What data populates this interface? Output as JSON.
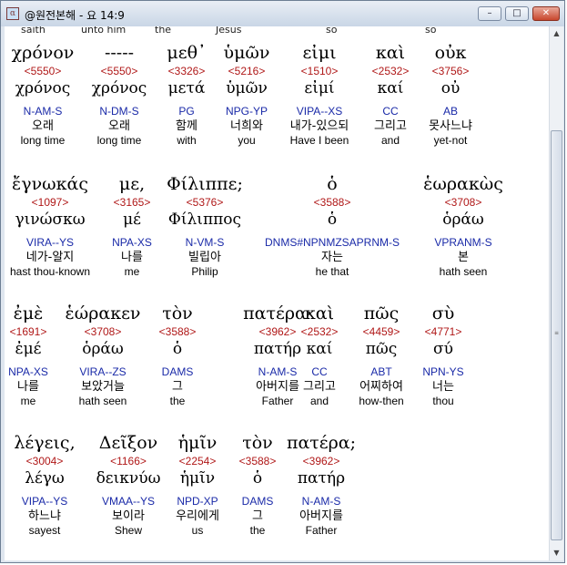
{
  "window": {
    "title": "@원전본해 - 요 14:9",
    "minimize_label": "–",
    "maximize_label": "□",
    "close_label": "✕"
  },
  "top_partial": [
    "saith",
    "unto him",
    "the",
    "Jesus",
    "so",
    "so"
  ],
  "rows": [
    {
      "words": [
        {
          "greek": "χρόνον",
          "strong": "<5550>",
          "lemma": "χρόνος",
          "parse": "N-AM-S",
          "korean": "오래",
          "english": "long time"
        },
        {
          "greek": "-----",
          "strong": "<5550>",
          "lemma": "χρόνος",
          "parse": "N-DM-S",
          "korean": "오래",
          "english": "long time"
        },
        {
          "greek": "μεθ᾽",
          "strong": "<3326>",
          "lemma": "μετά",
          "parse": "PG",
          "korean": "함께",
          "english": "with"
        },
        {
          "greek": "ὑμῶν",
          "strong": "<5216>",
          "lemma": "ὑμῶν",
          "parse": "NPG-YP",
          "korean": "너희와",
          "english": "you"
        },
        {
          "greek": "εἰμι",
          "strong": "<1510>",
          "lemma": "εἰμί",
          "parse": "VIPA--XS",
          "korean": "내가-있으되",
          "english": "Have I been"
        },
        {
          "greek": "καὶ",
          "strong": "<2532>",
          "lemma": "καί",
          "parse": "CC",
          "korean": "그리고",
          "english": "and"
        },
        {
          "greek": "οὐκ",
          "strong": "<3756>",
          "lemma": "οὐ",
          "parse": "AB",
          "korean": "못사느냐",
          "english": "yet-not"
        }
      ]
    },
    {
      "words": [
        {
          "greek": "ἔγνωκάς",
          "strong": "<1097>",
          "lemma": "γινώσκω",
          "parse": "VIRA--YS",
          "korean": "네가-알지",
          "english": "hast thou-known"
        },
        {
          "greek": "με,",
          "strong": "<3165>",
          "lemma": "μέ",
          "parse": "NPA-XS",
          "korean": "나를",
          "english": "me"
        },
        {
          "greek": "Φίλιππε;",
          "strong": "<5376>",
          "lemma": "Φίλιππος",
          "parse": "N-VM-S",
          "korean": "빌립아",
          "english": "Philip"
        },
        {
          "greek": "ὁ",
          "strong": "<3588>",
          "lemma": "ὁ",
          "parse": "DNMS#NPNMZSAPRNM-S",
          "korean": "자는",
          "english": "he that"
        },
        {
          "greek": "ἑωρακὼς",
          "strong": "<3708>",
          "lemma": "ὁράω",
          "parse": "VPRANM-S",
          "korean": "본",
          "english": "hath seen"
        }
      ]
    },
    {
      "words": [
        {
          "greek": "ἐμὲ",
          "strong": "<1691>",
          "lemma": "ἐμέ",
          "parse": "NPA-XS",
          "korean": "나를",
          "english": "me"
        },
        {
          "greek": "ἑώρακεν",
          "strong": "<3708>",
          "lemma": "ὁράω",
          "parse": "VIRA--ZS",
          "korean": "보았거늘",
          "english": "hath seen"
        },
        {
          "greek": "τὸν",
          "strong": "<3588>",
          "lemma": "ὁ",
          "parse": "DAMS",
          "korean": "그",
          "english": "the"
        },
        {
          "greek": "πατέρα·",
          "strong": "<3962>",
          "lemma": "πατήρ",
          "parse": "N-AM-S",
          "korean": "아버지를",
          "english": "Father"
        },
        {
          "greek": "καὶ",
          "strong": "<2532>",
          "lemma": "καί",
          "parse": "CC",
          "korean": "그리고",
          "english": "and"
        },
        {
          "greek": "πῶς",
          "strong": "<4459>",
          "lemma": "πῶς",
          "parse": "ABT",
          "korean": "어찌하여",
          "english": "how-then"
        },
        {
          "greek": "σὺ",
          "strong": "<4771>",
          "lemma": "σύ",
          "parse": "NPN-YS",
          "korean": "너는",
          "english": "thou"
        }
      ]
    },
    {
      "words": [
        {
          "greek": "λέγεις,",
          "strong": "<3004>",
          "lemma": "λέγω",
          "parse": "VIPA--YS",
          "korean": "하느냐",
          "english": "sayest"
        },
        {
          "greek": "Δεῖξον",
          "strong": "<1166>",
          "lemma": "δεικνύω",
          "parse": "VMAA--YS",
          "korean": "보이라",
          "english": "Shew"
        },
        {
          "greek": "ἡμῖν",
          "strong": "<2254>",
          "lemma": "ἡμῖν",
          "parse": "NPD-XP",
          "korean": "우리에게",
          "english": "us"
        },
        {
          "greek": "τὸν",
          "strong": "<3588>",
          "lemma": "ὁ",
          "parse": "DAMS",
          "korean": "그",
          "english": "the"
        },
        {
          "greek": "πατέρα;",
          "strong": "<3962>",
          "lemma": "πατήρ",
          "parse": "N-AM-S",
          "korean": "아버지를",
          "english": "Father"
        }
      ]
    }
  ]
}
